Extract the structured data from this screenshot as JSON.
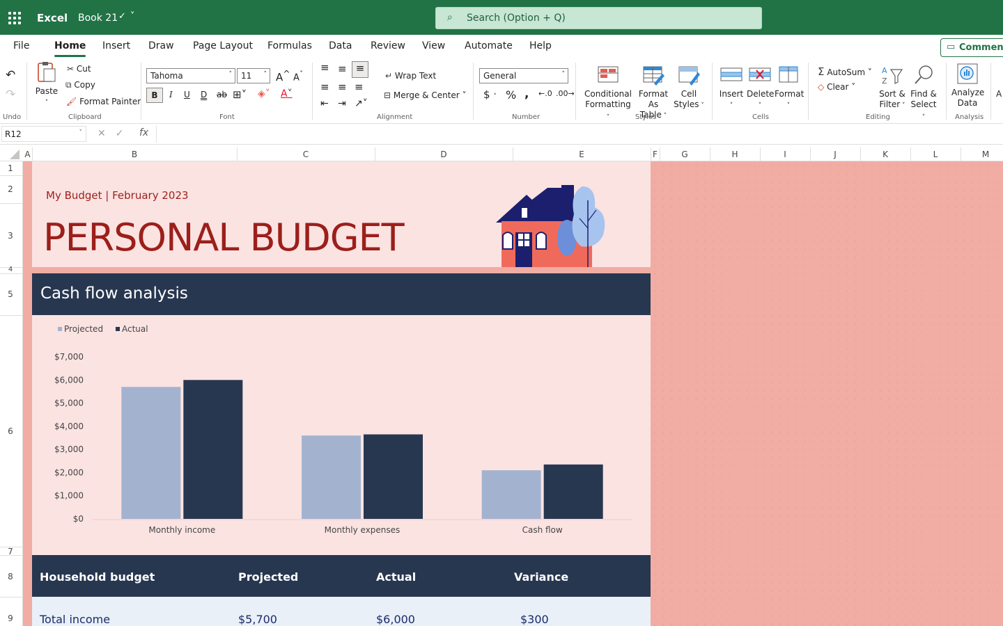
{
  "titlebar": {
    "app": "Excel",
    "book": "Book 21",
    "search_placeholder": "Search (Option + Q)"
  },
  "tabs": [
    "File",
    "Home",
    "Insert",
    "Draw",
    "Page Layout",
    "Formulas",
    "Data",
    "Review",
    "View",
    "Automate",
    "Help"
  ],
  "comment_label": "Comment",
  "ribbon": {
    "undo_group": "Undo",
    "paste": "Paste",
    "cut": "Cut",
    "copy": "Copy",
    "format_painter": "Format Painter",
    "clipboard_group": "Clipboard",
    "font_name": "Tahoma",
    "font_size": "11",
    "font_group": "Font",
    "wrap_text": "Wrap Text",
    "merge_center": "Merge & Center",
    "alignment_group": "Alignment",
    "number_format": "General",
    "number_group": "Number",
    "conditional_formatting_1": "Conditional",
    "conditional_formatting_2": "Formatting",
    "format_as_table_1": "Format As",
    "format_as_table_2": "Table",
    "cell_styles_1": "Cell",
    "cell_styles_2": "Styles",
    "styles_group": "Styles",
    "insert": "Insert",
    "delete": "Delete",
    "format": "Format",
    "cells_group": "Cells",
    "autosum": "AutoSum",
    "clear": "Clear",
    "sort_filter_1": "Sort &",
    "sort_filter_2": "Filter",
    "find_select_1": "Find &",
    "find_select_2": "Select",
    "editing_group": "Editing",
    "analyze_data_1": "Analyze",
    "analyze_data_2": "Data",
    "analysis_group": "Analysis"
  },
  "formula_bar": {
    "name_box": "R12",
    "fx": "fx"
  },
  "columns": [
    "A",
    "B",
    "C",
    "D",
    "E",
    "F",
    "G",
    "H",
    "I",
    "J",
    "K",
    "L",
    "M"
  ],
  "rows": [
    "1",
    "2",
    "3",
    "4",
    "5",
    "6",
    "7",
    "8",
    "9"
  ],
  "sheet": {
    "subtitle": "My Budget | February 2023",
    "title": "PERSONAL BUDGET",
    "section": "Cash flow analysis",
    "table_headers": [
      "Household budget",
      "Projected",
      "Actual",
      "Variance"
    ],
    "table_row": [
      "Total income",
      "$5,700",
      "$6,000",
      "$300"
    ]
  },
  "colors": {
    "projected": "#a3b3cf",
    "actual": "#283750",
    "accent": "#9c1f1a"
  },
  "chart_data": {
    "type": "bar",
    "categories": [
      "Monthly income",
      "Monthly expenses",
      "Cash flow"
    ],
    "series": [
      {
        "name": "Projected",
        "values": [
          5700,
          3600,
          2100
        ]
      },
      {
        "name": "Actual",
        "values": [
          6000,
          3650,
          2350
        ]
      }
    ],
    "y_ticks": [
      "$0",
      "$1,000",
      "$2,000",
      "$3,000",
      "$4,000",
      "$5,000",
      "$6,000",
      "$7,000"
    ],
    "ylim": [
      0,
      7000
    ],
    "legend": "top-left"
  }
}
